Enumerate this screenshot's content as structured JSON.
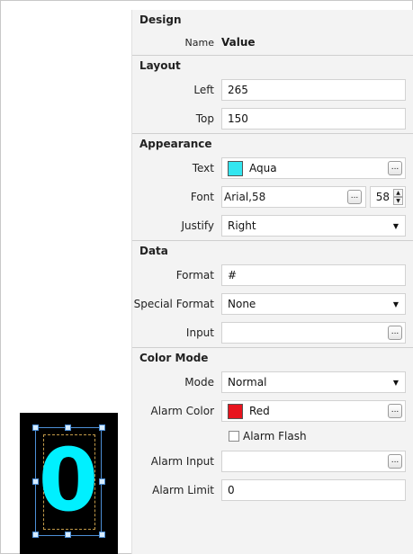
{
  "panel": {
    "sections": {
      "design": "Design",
      "layout": "Layout",
      "appearance": "Appearance",
      "data": "Data",
      "color_mode": "Color Mode"
    },
    "header": {
      "name_label": "Name",
      "value_label": "Value"
    },
    "layout": {
      "left_label": "Left",
      "left_value": "265",
      "top_label": "Top",
      "top_value": "150"
    },
    "appearance": {
      "text_label": "Text",
      "text_color_name": "Aqua",
      "text_color": "#33e6f0",
      "font_label": "Font",
      "font_value": "Arial,58",
      "font_size": "58",
      "justify_label": "Justify",
      "justify_value": "Right"
    },
    "data": {
      "format_label": "Format",
      "format_value": "#",
      "special_label": "Special Format",
      "special_value": "None",
      "input_label": "Input",
      "input_value": ""
    },
    "color_mode": {
      "mode_label": "Mode",
      "mode_value": "Normal",
      "alarm_color_label": "Alarm Color",
      "alarm_color_name": "Red",
      "alarm_color": "#e8141e",
      "alarm_flash_label": "Alarm Flash",
      "alarm_flash_checked": false,
      "alarm_input_label": "Alarm Input",
      "alarm_input_value": "",
      "alarm_limit_label": "Alarm Limit",
      "alarm_limit_value": "0"
    },
    "ellipsis": "...",
    "dropdown_glyph": "▼",
    "spin_up": "▲",
    "spin_down": "▼"
  },
  "preview": {
    "digit": "0",
    "digit_color": "#00f0ff"
  }
}
